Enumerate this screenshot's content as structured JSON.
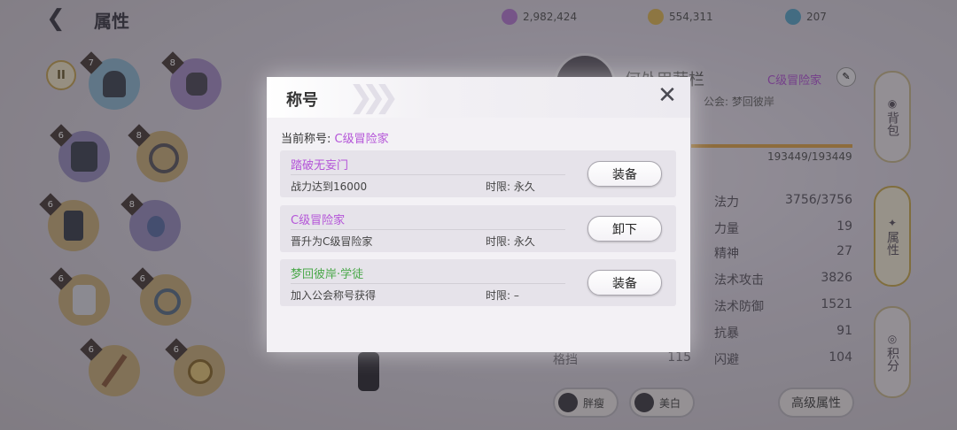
{
  "header": {
    "title": "属性"
  },
  "currencies": [
    {
      "icon": "purple-crystal-icon",
      "value": "2,982,424"
    },
    {
      "icon": "gold-coin-icon",
      "value": "554,311"
    },
    {
      "icon": "blue-gem-icon",
      "value": "207"
    }
  ],
  "equipment": [
    {
      "name": "helmet-icon",
      "level": "7"
    },
    {
      "name": "gloves-icon",
      "level": "8"
    },
    {
      "name": "armor-icon",
      "level": "6"
    },
    {
      "name": "necklace-icon",
      "level": "8"
    },
    {
      "name": "pants-icon",
      "level": "6"
    },
    {
      "name": "potion-icon",
      "level": "8"
    },
    {
      "name": "boots-icon",
      "level": "6"
    },
    {
      "name": "ring-icon",
      "level": "6"
    },
    {
      "name": "weapon-icon",
      "level": "6"
    },
    {
      "name": "medallion-icon",
      "level": "6"
    }
  ],
  "pause_label": "II",
  "character": {
    "name": "何处甲蔬栏",
    "title": "C级冒险家",
    "guild": "公会: 梦回彼岸",
    "hp": "193449/193449"
  },
  "stats": [
    {
      "label": "法力",
      "value": "3756/3756"
    },
    {
      "label": "力量",
      "value": "19"
    },
    {
      "label": "精神",
      "value": "27"
    },
    {
      "label": "法术攻击",
      "value": "3826"
    },
    {
      "label": "法术防御",
      "value": "1521"
    },
    {
      "label": "抗暴",
      "value": "91"
    },
    {
      "label": "闪避",
      "value": "104"
    }
  ],
  "extra_stat": {
    "label": "格挡",
    "value": "115"
  },
  "side_tabs": {
    "bag": "背包",
    "attr": "属性",
    "points": "积分"
  },
  "bottom_buttons": {
    "fat": "胖瘦",
    "white": "美白",
    "advanced": "高级属性"
  },
  "modal": {
    "title": "称号",
    "current_label": "当前称号:",
    "current_value": "C级冒险家",
    "titles": [
      {
        "name": "踏破无妄门",
        "name_color": "#b454d8",
        "desc": "战力达到16000",
        "limit": "时限: 永久",
        "button": "装备"
      },
      {
        "name": "C级冒险家",
        "name_color": "#b454d8",
        "desc": "晋升为C级冒险家",
        "limit": "时限: 永久",
        "button": "卸下"
      },
      {
        "name": "梦回彼岸·学徒",
        "name_color": "#4aa84a",
        "desc": "加入公会称号获得",
        "limit": "时限: –",
        "button": "装备"
      }
    ]
  },
  "colors": {
    "purple_title": "#b454d8",
    "green_title": "#4aa84a",
    "gold_border": "#c9b98f"
  }
}
